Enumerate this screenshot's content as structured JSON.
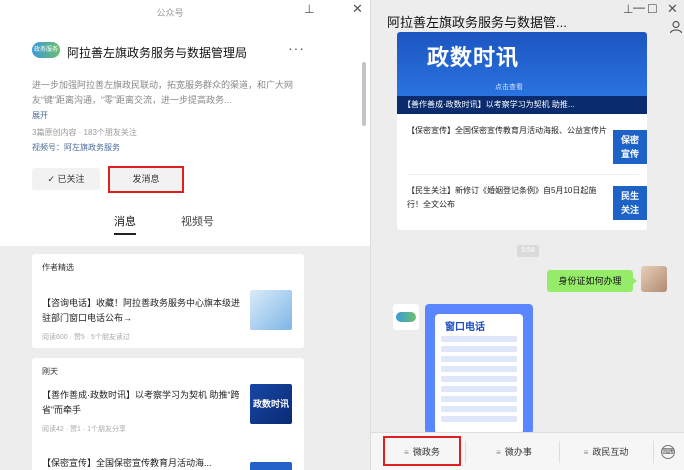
{
  "left": {
    "window_title": "公众号",
    "account_name": "阿拉善左旗政务服务与数据管理局",
    "logo_text": "政务服务",
    "intro": "进一步加强阿拉善左旗政民联动，拓宽服务群众的渠道，和广大网友“键”距离沟通，“零”距离交流，进一步提高政务...",
    "expand": "展开",
    "stats": "3篇原创内容 · 183个朋友关注",
    "channel": "视频号：阿左旗政务服务",
    "followed_label": "✓ 已关注",
    "send_label": "发消息",
    "tabs": [
      "消息",
      "视频号"
    ],
    "section1": {
      "header": "作者精选",
      "title": "【咨询电话】收藏！阿拉善政务服务中心旗本级进驻部门窗口电话公布→",
      "meta": "阅读600 · 赞5 · 5个朋友读过"
    },
    "section2": {
      "header": "刚天",
      "title": "【善作善成·政数时讯】以考察学习为契机 助推“跨省”而牵手",
      "meta": "阅读42 · 赞1 · 1个朋友分享",
      "thumb_text": "政数时讯",
      "next_title": "【保密宣传】全国保密宣传教育月活动海..."
    }
  },
  "right": {
    "title": "阿拉善左旗政务服务与数据管...",
    "news": {
      "banner_title": "政数时讯",
      "banner_sub": "点击查看",
      "caption": "【善作善成·政数时讯】以考察学习为契机 助推...",
      "items": [
        {
          "text": "【保密宣传】全国保密宣传教育月活动海报、公益宣传片",
          "badge": "保密\n宣传"
        },
        {
          "text": "【民生关注】新修订《婚姻登记条例》自5月10日起施行！全文公布",
          "badge": "民生\n关注"
        }
      ]
    },
    "time_stamp": "9:58",
    "user_message": "身份证如何办理",
    "image_title": "窗口电话",
    "menu": [
      "微政务",
      "微办事",
      "政民互动"
    ]
  }
}
